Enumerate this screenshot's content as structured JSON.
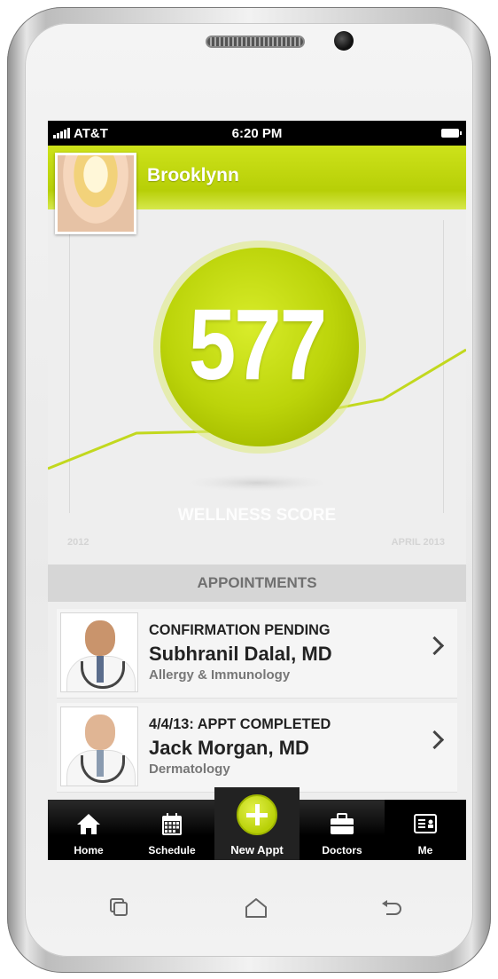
{
  "status_bar": {
    "carrier": "AT&T",
    "time": "6:20 PM"
  },
  "profile": {
    "name": "Brooklynn"
  },
  "wellness": {
    "score": "577",
    "label": "WELLNESS SCORE",
    "start_label": "2012",
    "end_label": "APRIL 2013",
    "accent_color": "#bcd40a"
  },
  "appointments": {
    "header": "APPOINTMENTS",
    "items": [
      {
        "status": "CONFIRMATION PENDING",
        "doctor": "Subhranil Dalal, MD",
        "specialty": "Allergy & Immunology"
      },
      {
        "status": "4/4/13: APPT COMPLETED",
        "doctor": "Jack Morgan, MD",
        "specialty": "Dermatology"
      }
    ]
  },
  "tabs": [
    {
      "label": "Home",
      "icon": "home-icon"
    },
    {
      "label": "Schedule",
      "icon": "calendar-icon"
    },
    {
      "label": "New Appt",
      "icon": "plus-icon"
    },
    {
      "label": "Doctors",
      "icon": "briefcase-icon"
    },
    {
      "label": "Me",
      "icon": "id-card-icon"
    }
  ],
  "android_nav": [
    "recent-apps-icon",
    "home-outline-icon",
    "back-icon"
  ]
}
